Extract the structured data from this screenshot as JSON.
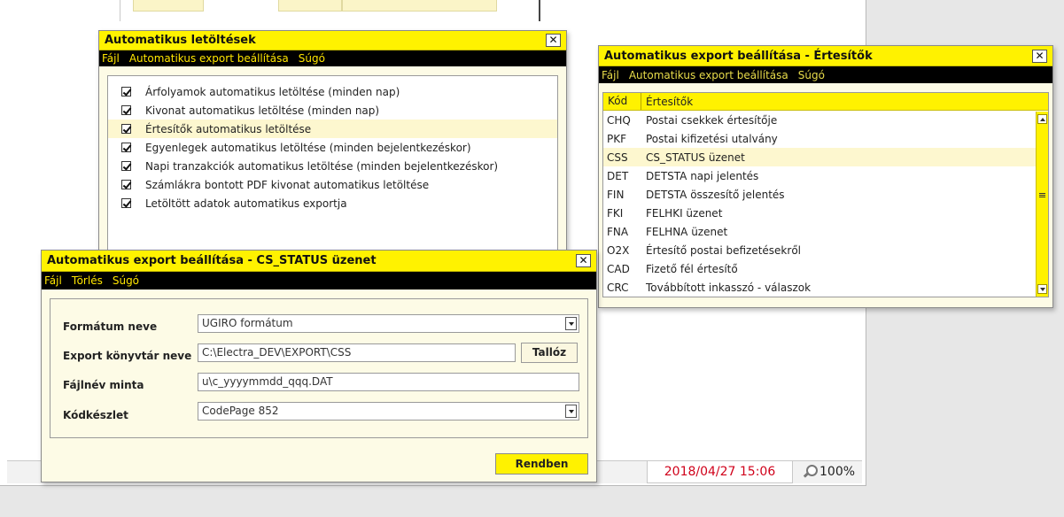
{
  "background": {
    "date": "2018/04/27 15:06",
    "zoom": "100%"
  },
  "win_auto_downloads": {
    "title": "Automatikus letöltések",
    "close": "✕",
    "menu": [
      "Fájl",
      "Automatikus export beállítása",
      "Súgó"
    ],
    "items": [
      "Árfolyamok automatikus letöltése (minden nap)",
      "Kivonat automatikus letöltése (minden nap)",
      "Értesítők automatikus letöltése",
      "Egyenlegek automatikus letöltése (minden bejelentkezéskor)",
      "Napi tranzakciók automatikus letöltése (minden bejelentkezéskor)",
      "Számlákra bontott PDF kivonat automatikus letöltése",
      "Letöltött adatok automatikus exportja"
    ]
  },
  "win_notifications": {
    "title": "Automatikus export beállítása - Értesítők",
    "close": "✕",
    "menu": [
      "Fájl",
      "Automatikus export beállítása",
      "Súgó"
    ],
    "headers": [
      "Kód",
      "Értesítők"
    ],
    "rows": [
      [
        "CHQ",
        "Postai csekkek értesítője"
      ],
      [
        "PKF",
        "Postai kifizetési utalvány"
      ],
      [
        "CSS",
        "CS_STATUS üzenet"
      ],
      [
        "DET",
        "DETSTA napi jelentés"
      ],
      [
        "FIN",
        "DETSTA összesítő jelentés"
      ],
      [
        "FKI",
        "FELHKI üzenet"
      ],
      [
        "FNA",
        "FELHNA üzenet"
      ],
      [
        "O2X",
        "Értesítő postai befizetésekről"
      ],
      [
        "CAD",
        "Fizető fél értesítő"
      ],
      [
        "CRC",
        "Továbbított inkasszó - válaszok"
      ]
    ]
  },
  "win_cs_status": {
    "title": "Automatikus export beállítása - CS_STATUS üzenet",
    "close": "✕",
    "menu": [
      "Fájl",
      "Törlés",
      "Súgó"
    ],
    "labels": {
      "format": "Formátum neve",
      "export_dir": "Export könyvtár neve",
      "filename": "Fájlnév minta",
      "charset": "Kódkészlet"
    },
    "values": {
      "format": "UGIRO formátum",
      "export_dir": "C:\\Electra_DEV\\EXPORT\\CSS",
      "filename": "u\\c_yyyymmdd_qqq.DAT",
      "charset": "CodePage 852"
    },
    "browse_button": "Tallóz",
    "ok_button": "Rendben"
  },
  "colors": {
    "accent_yellow": "#fff200",
    "menubar_black": "#000000",
    "row_alt": "#fdf7cf",
    "date_red": "#d0021b"
  }
}
